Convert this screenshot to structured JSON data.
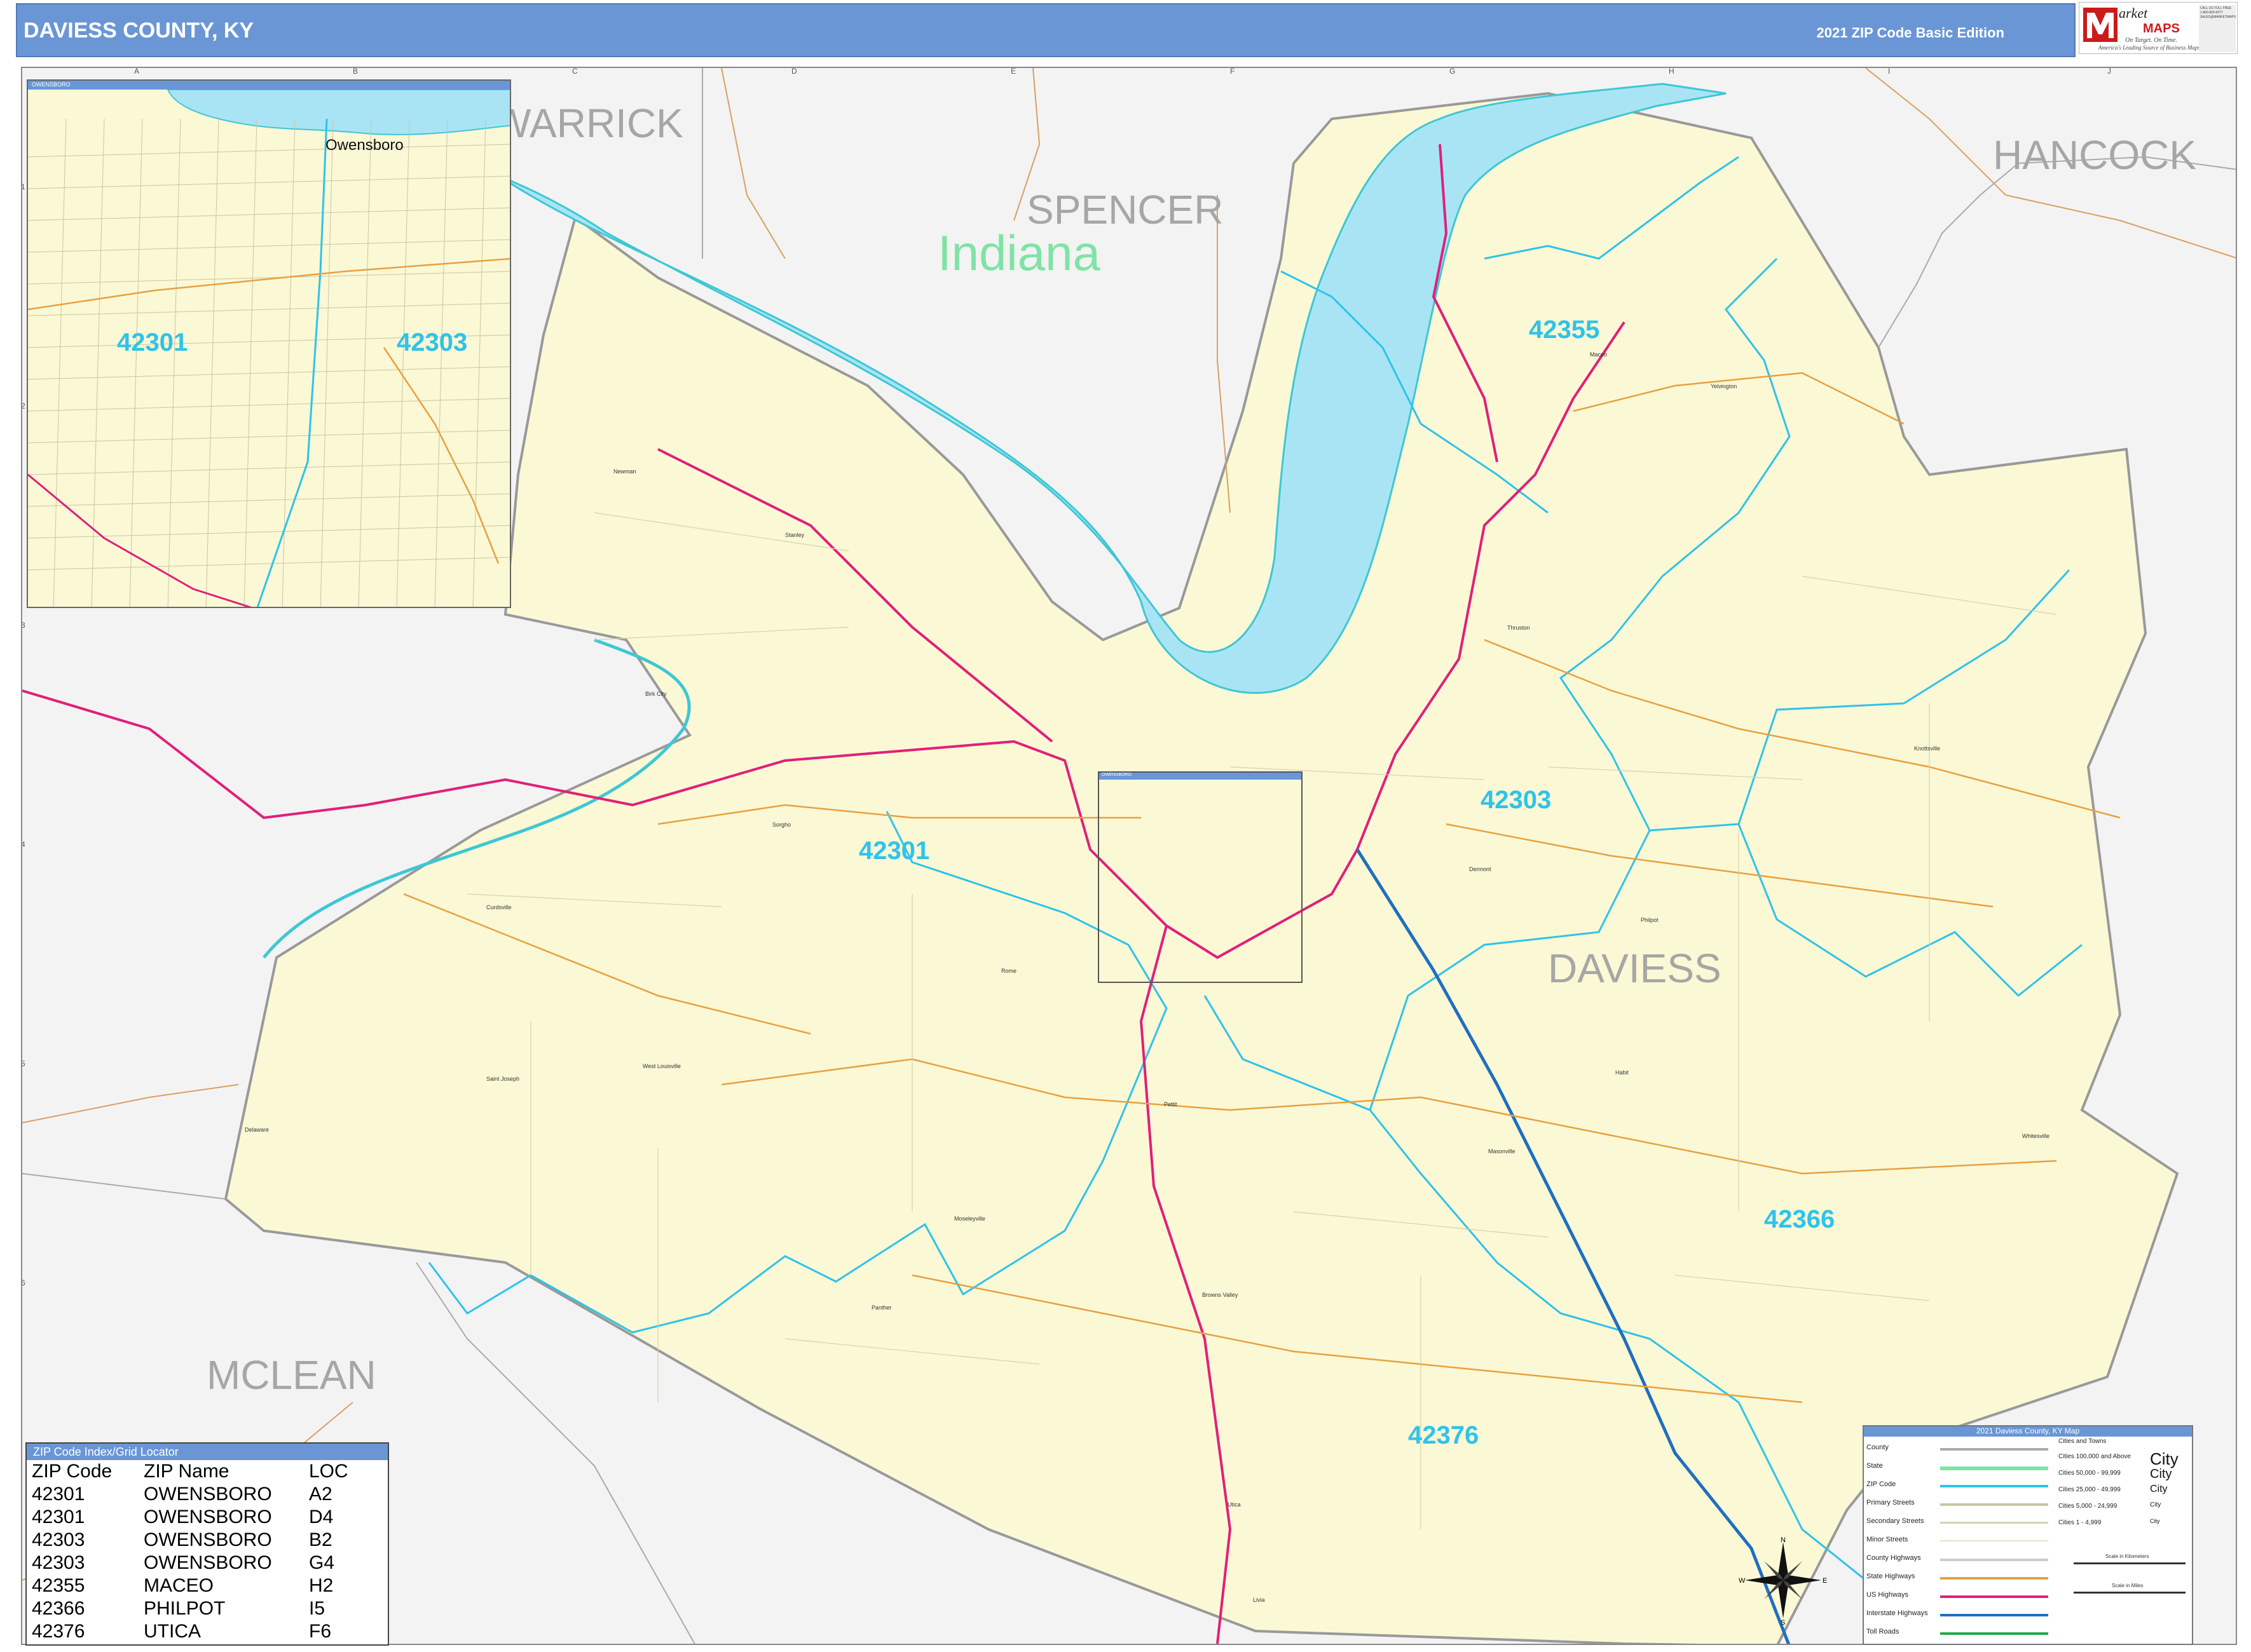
{
  "header": {
    "title": "DAVIESS COUNTY, KY",
    "edition": "2021 ZIP Code Basic Edition"
  },
  "logo": {
    "brand_line1": "arket",
    "brand_line2": "MAPS",
    "tagline1": "On Target. On Time.",
    "tagline2": "America's Leading Source of Business Maps",
    "contact": "CALL US TOLL FREE 1-800-829-6277 SALES@MARKETMAPS.COM"
  },
  "grid": {
    "columns": [
      "A",
      "B",
      "C",
      "D",
      "E",
      "F",
      "G",
      "H",
      "I",
      "J"
    ],
    "rows": [
      "1",
      "2",
      "3",
      "4",
      "5",
      "6"
    ]
  },
  "labels": {
    "counties": [
      "WARRICK",
      "SPENCER",
      "HANCOCK",
      "DAVIESS",
      "MCLEAN"
    ],
    "state": "Indiana",
    "zips": [
      "42355",
      "42303",
      "42301",
      "42366",
      "42376"
    ],
    "towns": [
      "Newman",
      "Stanley",
      "Birk City",
      "Sorgho",
      "Curdsville",
      "Saint Joseph",
      "Delaware",
      "West Louisville",
      "Rome",
      "Pettit",
      "Masonville",
      "Habit",
      "Philpot",
      "Dermont",
      "Knottsville",
      "Whitesville",
      "Maceo",
      "Yelvington",
      "Thruston",
      "Philpot",
      "Browns Valley",
      "Panther",
      "Utica",
      "Livia",
      "Moseleyville"
    ]
  },
  "inset": {
    "title": "OWENSBORO",
    "city": "Owensboro",
    "zips": [
      "42301",
      "42303"
    ]
  },
  "detail_box": {
    "title": "OWENSBORO"
  },
  "zip_index": {
    "title": "ZIP Code Index/Grid Locator",
    "headers": [
      "ZIP Code",
      "ZIP Name",
      "LOC"
    ],
    "rows": [
      [
        "42301",
        "OWENSBORO",
        "A2"
      ],
      [
        "42301",
        "OWENSBORO",
        "D4"
      ],
      [
        "42303",
        "OWENSBORO",
        "B2"
      ],
      [
        "42303",
        "OWENSBORO",
        "G4"
      ],
      [
        "42355",
        "MACEO",
        "H2"
      ],
      [
        "42366",
        "PHILPOT",
        "I5"
      ],
      [
        "42376",
        "UTICA",
        "F6"
      ]
    ]
  },
  "legend": {
    "title": "2021 Daviess County, KY Map",
    "items": [
      "County",
      "State",
      "ZIP Code",
      "Primary Streets",
      "Secondary Streets",
      "Minor Streets",
      "County Highways",
      "State Highways",
      "US Highways",
      "Interstate Highways",
      "Toll Roads"
    ],
    "cities_title": "Cities and Towns",
    "cities": [
      "Cities 100,000 and Above",
      "Cities 50,000 - 99,999",
      "Cities 25,000 - 49,999",
      "Cities 5,000 - 24,999",
      "Cities 1 - 4,999"
    ],
    "city_sample": "City",
    "scale_km": "Scale in Kilometers",
    "scale_mi": "Scale in Miles"
  },
  "compass": {
    "n": "N",
    "s": "S",
    "e": "E",
    "w": "W"
  },
  "colors": {
    "header": "#6a96d6",
    "county_fill": "#fbf8d5",
    "outside": "#f3f3f3",
    "water": "#a9e4f5",
    "zip_line": "#2ec3ea",
    "us_highway": "#e0207a",
    "interstate": "#1f6fc0",
    "state_highway": "#e8a040"
  }
}
